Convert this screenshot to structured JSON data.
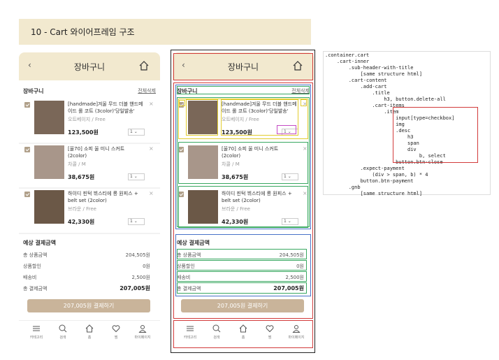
{
  "banner": {
    "title": "10 - Cart 와이어프레임 구조"
  },
  "app": {
    "back_icon": "‹",
    "title": "장바구니",
    "home_icon": "home-icon",
    "cart_title": "장바구니",
    "delete_all": "전체삭제",
    "items": [
      {
        "name": "[handmade]겨울 무드 더블 핸드메이드 롤 코트 (3color)'당일발송'",
        "option": "오트베이지 / Free",
        "price": "123,500원",
        "qty": "1"
      },
      {
        "name": "[울70] 소피 울 미니 스커트 (2color)",
        "option": "차콜 / M",
        "price": "38,675원",
        "qty": "1"
      },
      {
        "name": "하이디 핀턱 뷔스티에 롱 원피스 + belt set (2color)",
        "option": "브라운 / Free",
        "price": "42,330원",
        "qty": "1"
      }
    ],
    "remove_icon": "×",
    "payment_title": "예상 결제금액",
    "payment_rows": [
      {
        "label": "총 상품금액",
        "value": "204,505원"
      },
      {
        "label": "상품할인",
        "value": "0원"
      },
      {
        "label": "배송비",
        "value": "2,500원"
      },
      {
        "label": "총 결제금액",
        "value": "207,005원"
      }
    ],
    "pay_button": "207,005원 결제하기",
    "gnb": [
      {
        "icon": "menu-icon",
        "label": "카테고리"
      },
      {
        "icon": "search-icon",
        "label": "검색"
      },
      {
        "icon": "home-icon",
        "label": "홈"
      },
      {
        "icon": "heart-icon",
        "label": "찜"
      },
      {
        "icon": "user-icon",
        "label": "마이페이지"
      }
    ]
  },
  "code": {
    "lines": [
      ".container.cart",
      "    .cart-inner",
      "        .sub-header-with-title",
      "            [same structure html]",
      "        .cart-content",
      "            .add-cart",
      "                .title",
      "                    h3, button.delete-all",
      "                .cart-items",
      "                    .item",
      "                        input[type=checkbox]",
      "                        img",
      "                        .desc",
      "                            h3",
      "                            span",
      "                            div",
      "                                b, select",
      "                        button.btn-close",
      "            .expect-payment",
      "                (div > span, b) * 4",
      "            button.btn-payment",
      "        .gnb",
      "            [same structure html]"
    ]
  },
  "colors": {
    "header_bg": "#f2e9cf",
    "button_bg": "#c9b49a",
    "red": "#d23b3b",
    "blue": "#4872c8",
    "green": "#39a861",
    "yellow": "#e2cc2e",
    "magenta": "#c44bc4"
  }
}
